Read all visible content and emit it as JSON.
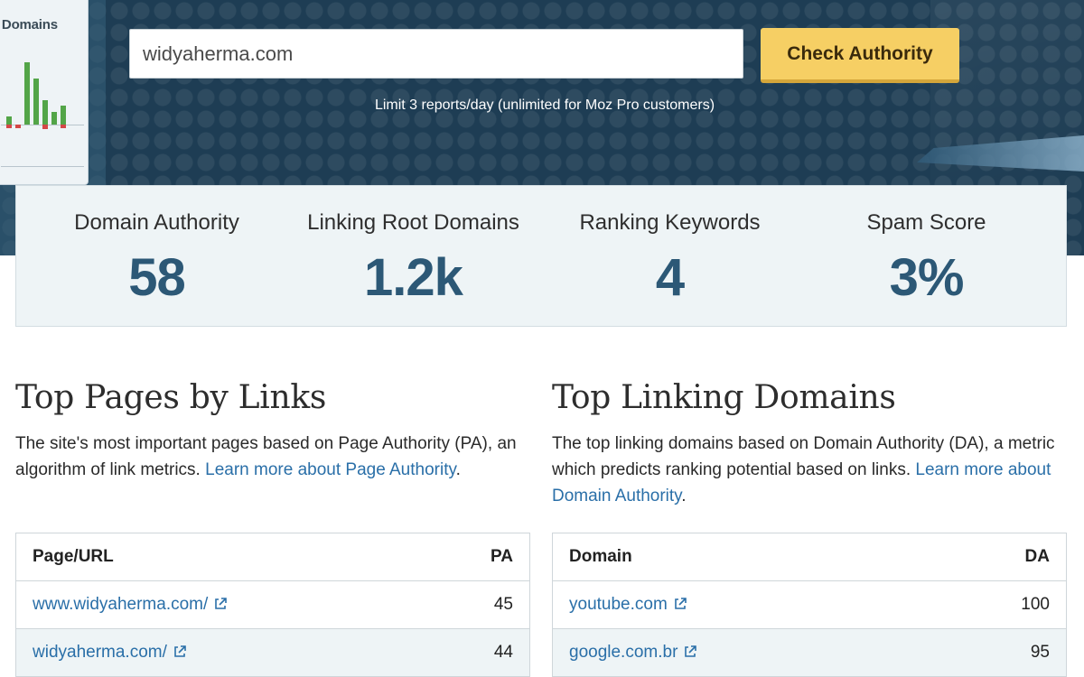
{
  "hero": {
    "side_card_title": "g Domains",
    "search_value": "widyaherma.com",
    "check_button_label": "Check Authority",
    "limit_text": "Limit 3 reports/day (unlimited for Moz Pro customers)"
  },
  "metrics": [
    {
      "label": "Domain Authority",
      "value": "58"
    },
    {
      "label": "Linking Root Domains",
      "value": "1.2k"
    },
    {
      "label": "Ranking Keywords",
      "value": "4"
    },
    {
      "label": "Spam Score",
      "value": "3%"
    }
  ],
  "top_pages": {
    "title": "Top Pages by Links",
    "desc_text": "The site's most important pages based on Page Authority (PA), an algorithm of link metrics. ",
    "desc_link": "Learn more about Page Authority",
    "desc_end": ".",
    "col_url": "Page/URL",
    "col_score": "PA",
    "rows": [
      {
        "url": "www.widyaherma.com/",
        "score": "45"
      },
      {
        "url": "widyaherma.com/",
        "score": "44"
      }
    ]
  },
  "top_domains": {
    "title": "Top Linking Domains",
    "desc_text": "The top linking domains based on Domain Authority (DA), a metric which predicts ranking potential based on links. ",
    "desc_link": "Learn more about Domain Authority",
    "desc_end": ".",
    "col_url": "Domain",
    "col_score": "DA",
    "rows": [
      {
        "url": "youtube.com",
        "score": "100"
      },
      {
        "url": "google.com.br",
        "score": "95"
      }
    ]
  },
  "colors": {
    "hero_bg": "#1e3d54",
    "button": "#f6cf64",
    "metric_value": "#2c5876",
    "link": "#2a6fa8"
  },
  "icons": [
    "external-link-icon"
  ]
}
